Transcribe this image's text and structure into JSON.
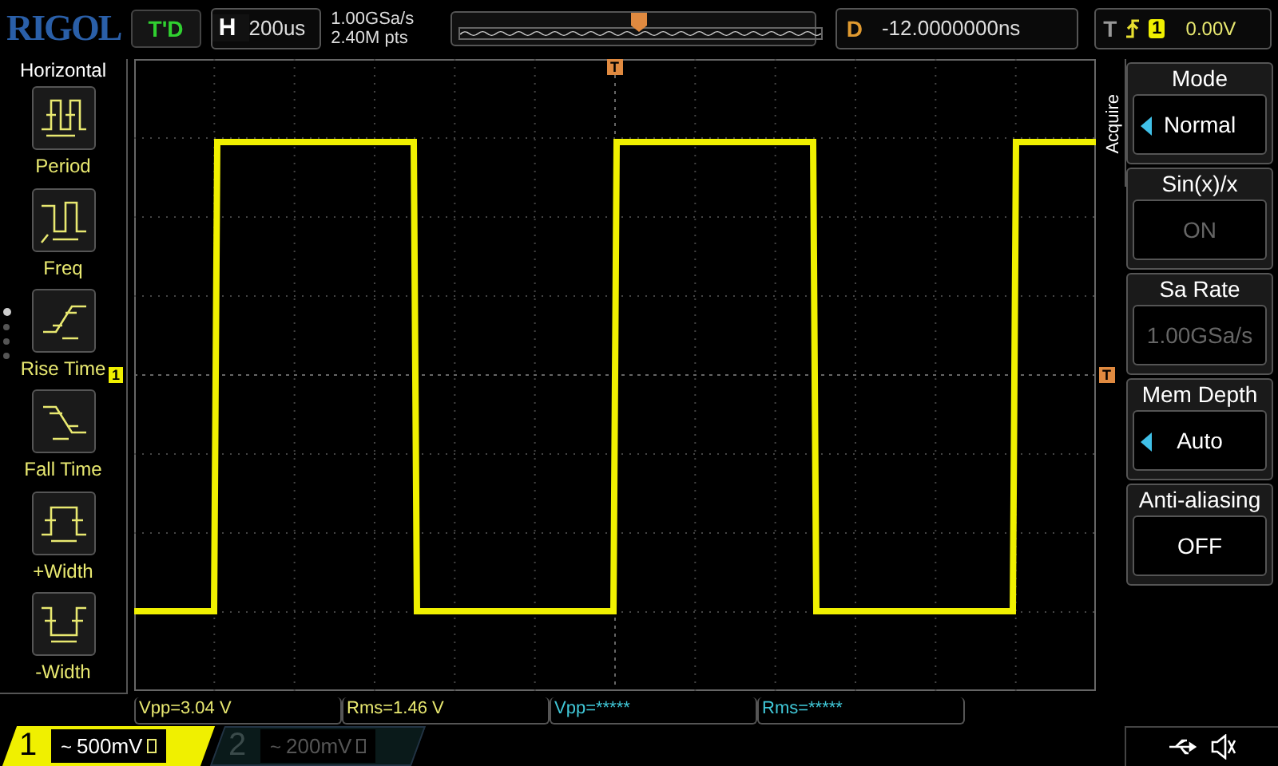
{
  "logo": "RIGOL",
  "run_state": "T'D",
  "timebase": {
    "label": "H",
    "value": "200us"
  },
  "sampling": {
    "rate": "1.00GSa/s",
    "points": "2.40M pts"
  },
  "delay": {
    "label": "D",
    "value": "-12.0000000ns"
  },
  "trigger": {
    "label": "T",
    "channel": "1",
    "level": "0.00V"
  },
  "grid_markers": {
    "trigger_top": "T",
    "channel_1": "1",
    "trigger_level": "T"
  },
  "left_menu": {
    "title": "Horizontal",
    "items": [
      {
        "kind": "period",
        "label": "Period"
      },
      {
        "kind": "freq",
        "label": "Freq"
      },
      {
        "kind": "rise",
        "label": "Rise Time"
      },
      {
        "kind": "fall",
        "label": "Fall Time"
      },
      {
        "kind": "pwidth",
        "label": "+Width"
      },
      {
        "kind": "nwidth",
        "label": "-Width"
      }
    ],
    "pages": [
      {
        "selected": true
      },
      {
        "selected": false
      },
      {
        "selected": false
      },
      {
        "selected": false
      }
    ]
  },
  "right_menu": {
    "title": "Acquire",
    "items": [
      {
        "label": "Mode",
        "value": "Normal",
        "kind": "select",
        "disabled": false
      },
      {
        "label": "Sin(x)/x",
        "value": "ON",
        "kind": "toggle",
        "disabled": true
      },
      {
        "label": "Sa Rate",
        "value": "1.00GSa/s",
        "kind": "toggle",
        "disabled": true
      },
      {
        "label": "Mem Depth",
        "value": "Auto",
        "kind": "select",
        "disabled": false
      },
      {
        "label": "Anti-aliasing",
        "value": "OFF",
        "kind": "toggle",
        "disabled": false
      }
    ]
  },
  "measurements": [
    {
      "text": "Vpp=3.04 V",
      "color": "#e8e870"
    },
    {
      "text": "Rms=1.46 V",
      "color": "#e8e870"
    },
    {
      "text": "Vpp=*****",
      "color": "#40c8d8"
    },
    {
      "text": "Rms=*****",
      "color": "#40c8d8"
    }
  ],
  "channels": [
    {
      "number": "1",
      "coupling": "~",
      "scale": "500mV",
      "selected": true
    },
    {
      "number": "2",
      "coupling": "~",
      "scale": "200mV",
      "selected": false
    }
  ]
}
